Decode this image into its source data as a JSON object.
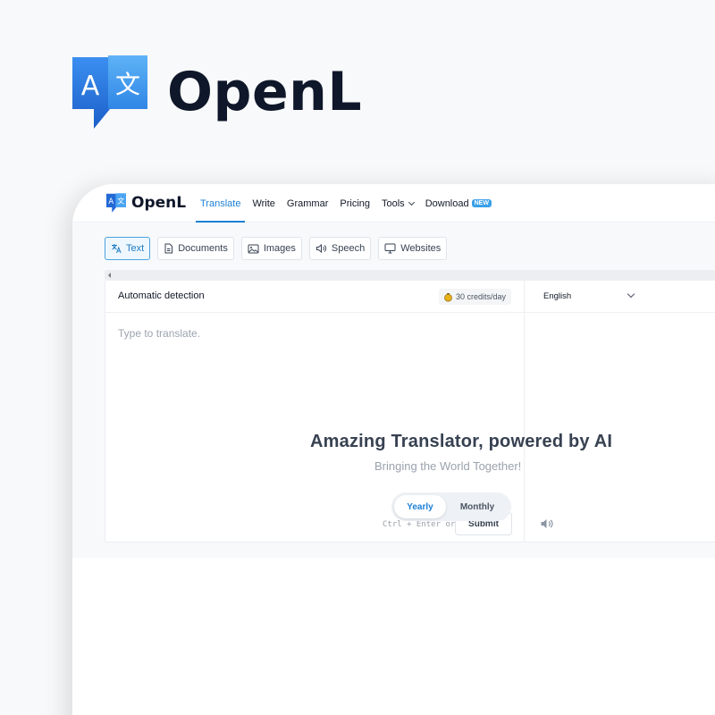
{
  "brand": {
    "name": "OpenL",
    "logo_left_glyph": "A",
    "logo_right_glyph": "文"
  },
  "nav": {
    "brand_name": "OpenL",
    "links": [
      {
        "label": "Translate",
        "active": true
      },
      {
        "label": "Write"
      },
      {
        "label": "Grammar"
      },
      {
        "label": "Pricing"
      },
      {
        "label": "Tools"
      },
      {
        "label": "Download"
      }
    ],
    "new_badge": "NEW"
  },
  "modes": [
    {
      "label": "Text",
      "icon": "translate-icon",
      "active": true
    },
    {
      "label": "Documents",
      "icon": "document-icon"
    },
    {
      "label": "Images",
      "icon": "image-icon"
    },
    {
      "label": "Speech",
      "icon": "speaker-icon"
    },
    {
      "label": "Websites",
      "icon": "monitor-icon"
    }
  ],
  "source": {
    "label": "Automatic detection",
    "credits": "30 credits/day",
    "placeholder": "Type to translate.",
    "shortcut_hint": "Ctrl + Enter or",
    "submit_label": "Submit"
  },
  "target": {
    "language": "English"
  },
  "hero": {
    "title": "Amazing Translator, powered by AI",
    "subtitle": "Bringing the World Together!"
  },
  "billing": {
    "yearly": "Yearly",
    "monthly": "Monthly",
    "selected": "Yearly"
  },
  "colors": {
    "accent": "#1d80d6",
    "brand_dark": "#0f172a",
    "logo_blue": "#2a7de1"
  }
}
